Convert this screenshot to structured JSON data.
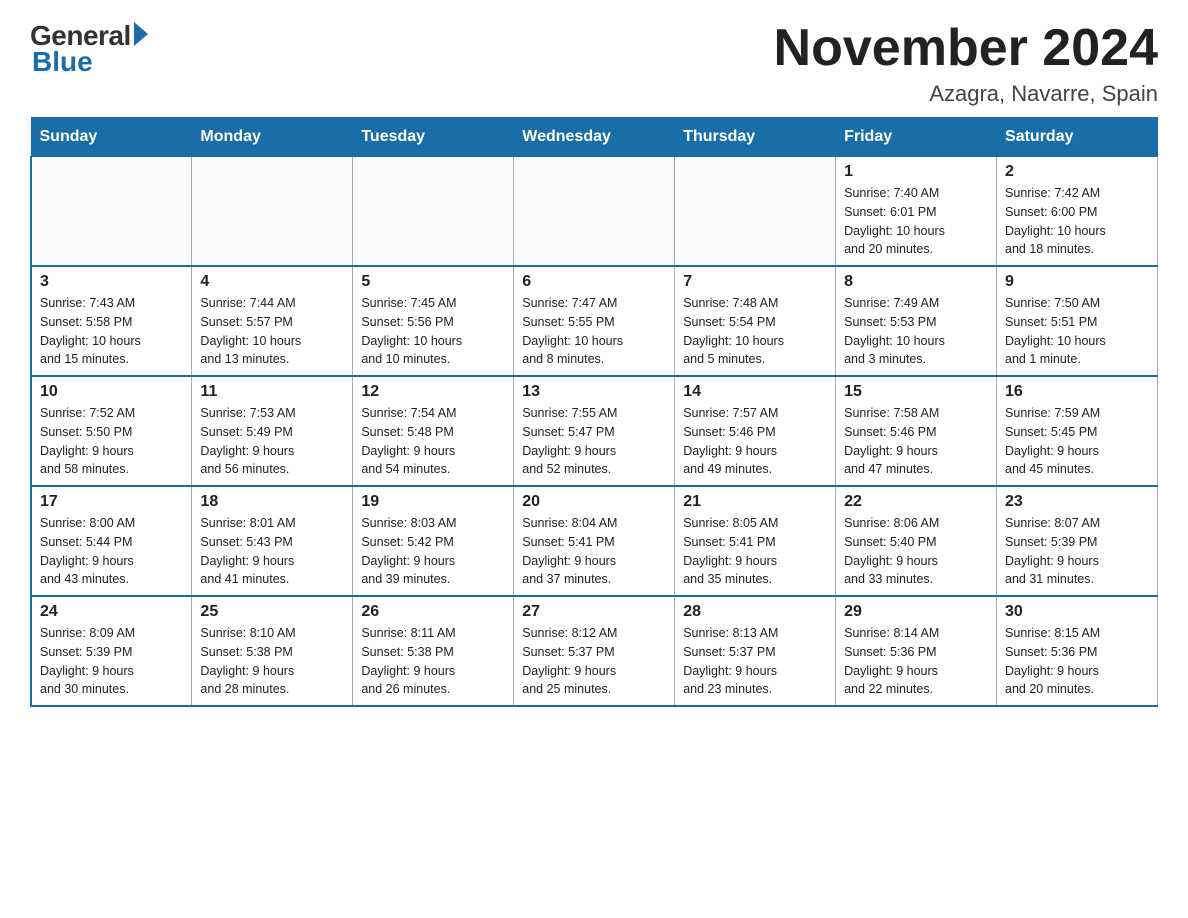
{
  "logo": {
    "general": "General",
    "blue": "Blue"
  },
  "title": "November 2024",
  "subtitle": "Azagra, Navarre, Spain",
  "weekdays": [
    "Sunday",
    "Monday",
    "Tuesday",
    "Wednesday",
    "Thursday",
    "Friday",
    "Saturday"
  ],
  "weeks": [
    [
      {
        "day": "",
        "info": ""
      },
      {
        "day": "",
        "info": ""
      },
      {
        "day": "",
        "info": ""
      },
      {
        "day": "",
        "info": ""
      },
      {
        "day": "",
        "info": ""
      },
      {
        "day": "1",
        "info": "Sunrise: 7:40 AM\nSunset: 6:01 PM\nDaylight: 10 hours\nand 20 minutes."
      },
      {
        "day": "2",
        "info": "Sunrise: 7:42 AM\nSunset: 6:00 PM\nDaylight: 10 hours\nand 18 minutes."
      }
    ],
    [
      {
        "day": "3",
        "info": "Sunrise: 7:43 AM\nSunset: 5:58 PM\nDaylight: 10 hours\nand 15 minutes."
      },
      {
        "day": "4",
        "info": "Sunrise: 7:44 AM\nSunset: 5:57 PM\nDaylight: 10 hours\nand 13 minutes."
      },
      {
        "day": "5",
        "info": "Sunrise: 7:45 AM\nSunset: 5:56 PM\nDaylight: 10 hours\nand 10 minutes."
      },
      {
        "day": "6",
        "info": "Sunrise: 7:47 AM\nSunset: 5:55 PM\nDaylight: 10 hours\nand 8 minutes."
      },
      {
        "day": "7",
        "info": "Sunrise: 7:48 AM\nSunset: 5:54 PM\nDaylight: 10 hours\nand 5 minutes."
      },
      {
        "day": "8",
        "info": "Sunrise: 7:49 AM\nSunset: 5:53 PM\nDaylight: 10 hours\nand 3 minutes."
      },
      {
        "day": "9",
        "info": "Sunrise: 7:50 AM\nSunset: 5:51 PM\nDaylight: 10 hours\nand 1 minute."
      }
    ],
    [
      {
        "day": "10",
        "info": "Sunrise: 7:52 AM\nSunset: 5:50 PM\nDaylight: 9 hours\nand 58 minutes."
      },
      {
        "day": "11",
        "info": "Sunrise: 7:53 AM\nSunset: 5:49 PM\nDaylight: 9 hours\nand 56 minutes."
      },
      {
        "day": "12",
        "info": "Sunrise: 7:54 AM\nSunset: 5:48 PM\nDaylight: 9 hours\nand 54 minutes."
      },
      {
        "day": "13",
        "info": "Sunrise: 7:55 AM\nSunset: 5:47 PM\nDaylight: 9 hours\nand 52 minutes."
      },
      {
        "day": "14",
        "info": "Sunrise: 7:57 AM\nSunset: 5:46 PM\nDaylight: 9 hours\nand 49 minutes."
      },
      {
        "day": "15",
        "info": "Sunrise: 7:58 AM\nSunset: 5:46 PM\nDaylight: 9 hours\nand 47 minutes."
      },
      {
        "day": "16",
        "info": "Sunrise: 7:59 AM\nSunset: 5:45 PM\nDaylight: 9 hours\nand 45 minutes."
      }
    ],
    [
      {
        "day": "17",
        "info": "Sunrise: 8:00 AM\nSunset: 5:44 PM\nDaylight: 9 hours\nand 43 minutes."
      },
      {
        "day": "18",
        "info": "Sunrise: 8:01 AM\nSunset: 5:43 PM\nDaylight: 9 hours\nand 41 minutes."
      },
      {
        "day": "19",
        "info": "Sunrise: 8:03 AM\nSunset: 5:42 PM\nDaylight: 9 hours\nand 39 minutes."
      },
      {
        "day": "20",
        "info": "Sunrise: 8:04 AM\nSunset: 5:41 PM\nDaylight: 9 hours\nand 37 minutes."
      },
      {
        "day": "21",
        "info": "Sunrise: 8:05 AM\nSunset: 5:41 PM\nDaylight: 9 hours\nand 35 minutes."
      },
      {
        "day": "22",
        "info": "Sunrise: 8:06 AM\nSunset: 5:40 PM\nDaylight: 9 hours\nand 33 minutes."
      },
      {
        "day": "23",
        "info": "Sunrise: 8:07 AM\nSunset: 5:39 PM\nDaylight: 9 hours\nand 31 minutes."
      }
    ],
    [
      {
        "day": "24",
        "info": "Sunrise: 8:09 AM\nSunset: 5:39 PM\nDaylight: 9 hours\nand 30 minutes."
      },
      {
        "day": "25",
        "info": "Sunrise: 8:10 AM\nSunset: 5:38 PM\nDaylight: 9 hours\nand 28 minutes."
      },
      {
        "day": "26",
        "info": "Sunrise: 8:11 AM\nSunset: 5:38 PM\nDaylight: 9 hours\nand 26 minutes."
      },
      {
        "day": "27",
        "info": "Sunrise: 8:12 AM\nSunset: 5:37 PM\nDaylight: 9 hours\nand 25 minutes."
      },
      {
        "day": "28",
        "info": "Sunrise: 8:13 AM\nSunset: 5:37 PM\nDaylight: 9 hours\nand 23 minutes."
      },
      {
        "day": "29",
        "info": "Sunrise: 8:14 AM\nSunset: 5:36 PM\nDaylight: 9 hours\nand 22 minutes."
      },
      {
        "day": "30",
        "info": "Sunrise: 8:15 AM\nSunset: 5:36 PM\nDaylight: 9 hours\nand 20 minutes."
      }
    ]
  ]
}
